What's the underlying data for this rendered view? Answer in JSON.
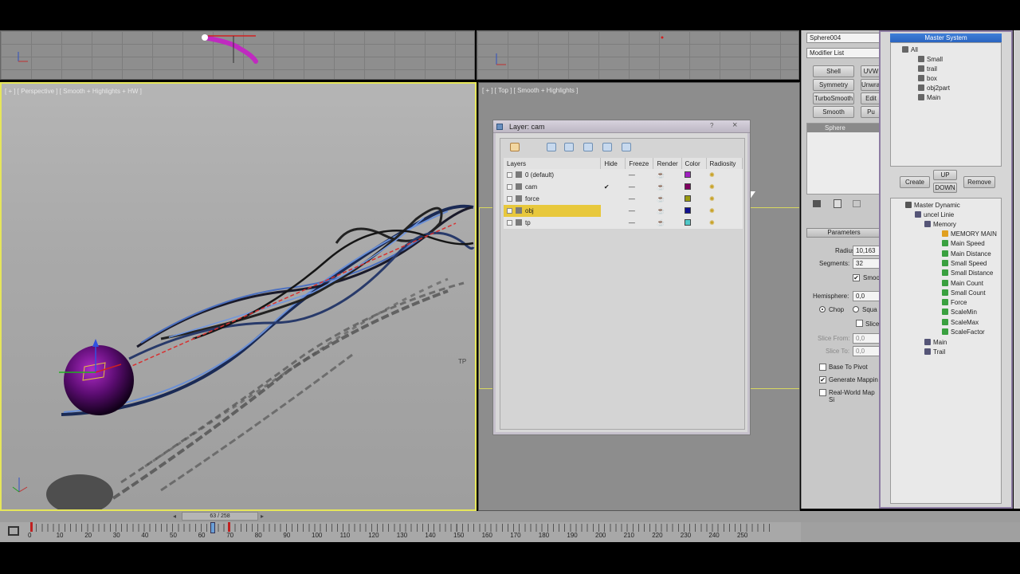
{
  "viewports": {
    "perspective_label": "[ + ] [ Perspective ] [ Smooth + Highlights + HW ]",
    "top_label": "[ + ] [ Top ] [ Smooth + Highlights ]",
    "scene_label": "TP"
  },
  "layer_dialog": {
    "title": "Layer: cam",
    "help": "?",
    "close": "×",
    "columns": [
      "Layers",
      "Hide",
      "Freeze",
      "Render",
      "Color",
      "Radiosity"
    ],
    "rows": [
      {
        "name": "0 (default)",
        "hide": "",
        "freeze": "—",
        "color": "#a020c0",
        "selected": false
      },
      {
        "name": "cam",
        "hide": "✔",
        "freeze": "—",
        "color": "#800060",
        "selected": false
      },
      {
        "name": "force",
        "hide": "",
        "freeze": "—",
        "color": "#9a9a10",
        "selected": false
      },
      {
        "name": "obj",
        "hide": "",
        "freeze": "—",
        "color": "#101090",
        "selected": true
      },
      {
        "name": "tp",
        "hide": "",
        "freeze": "—",
        "color": "#50c8c8",
        "selected": false
      }
    ]
  },
  "command_panel": {
    "object_name": "Sphere004",
    "modifier_list": "Modifier List",
    "buttons": [
      "Shell",
      "UVW",
      "Symmetry",
      "Unwrap",
      "TurboSmooth",
      "Edit",
      "Smooth",
      "Pu"
    ],
    "stack_item": "Sphere",
    "parameters_title": "Parameters",
    "radius_label": "Radius:",
    "radius_value": "10,163",
    "segments_label": "Segments:",
    "segments_value": "32",
    "smooth_label": "Smoo",
    "hemisphere_label": "Hemisphere:",
    "hemisphere_value": "0,0",
    "chop_label": "Chop",
    "squash_label": "Squa",
    "slice_label": "Slice",
    "slice_from_label": "Slice From:",
    "slice_from_value": "0,0",
    "slice_to_label": "Slice To:",
    "slice_to_value": "0,0",
    "base_to_pivot": "Base To Pivot",
    "generate_mapping": "Generate Mappin",
    "real_world": "Real-World Map Si"
  },
  "master_system": {
    "title": "Master System",
    "tree1": [
      "All",
      "Small",
      "trail",
      "box",
      "obj2part",
      "Main"
    ],
    "create": "Create",
    "up": "UP",
    "down": "DOWN",
    "remove": "Remove",
    "tree2_root": "Master Dynamic",
    "tree2_child": "uncel Linie",
    "tree2_group": "Memory",
    "tree2_items": [
      "MEMORY MAIN",
      "Main Speed",
      "Main Distance",
      "Small Speed",
      "Small Distance",
      "Main Count",
      "Small Count",
      "Force",
      "ScaleMin",
      "ScaleMax",
      "ScaleFactor"
    ],
    "tree2_tail": [
      "Main",
      "Trail"
    ]
  },
  "timeline": {
    "frame_display": "63 / 258",
    "ticks": [
      "0",
      "10",
      "20",
      "30",
      "40",
      "50",
      "60",
      "70",
      "80",
      "90",
      "100",
      "110",
      "120",
      "130",
      "140",
      "150",
      "160",
      "170",
      "180",
      "190",
      "200",
      "210",
      "220",
      "230",
      "240",
      "250"
    ]
  }
}
